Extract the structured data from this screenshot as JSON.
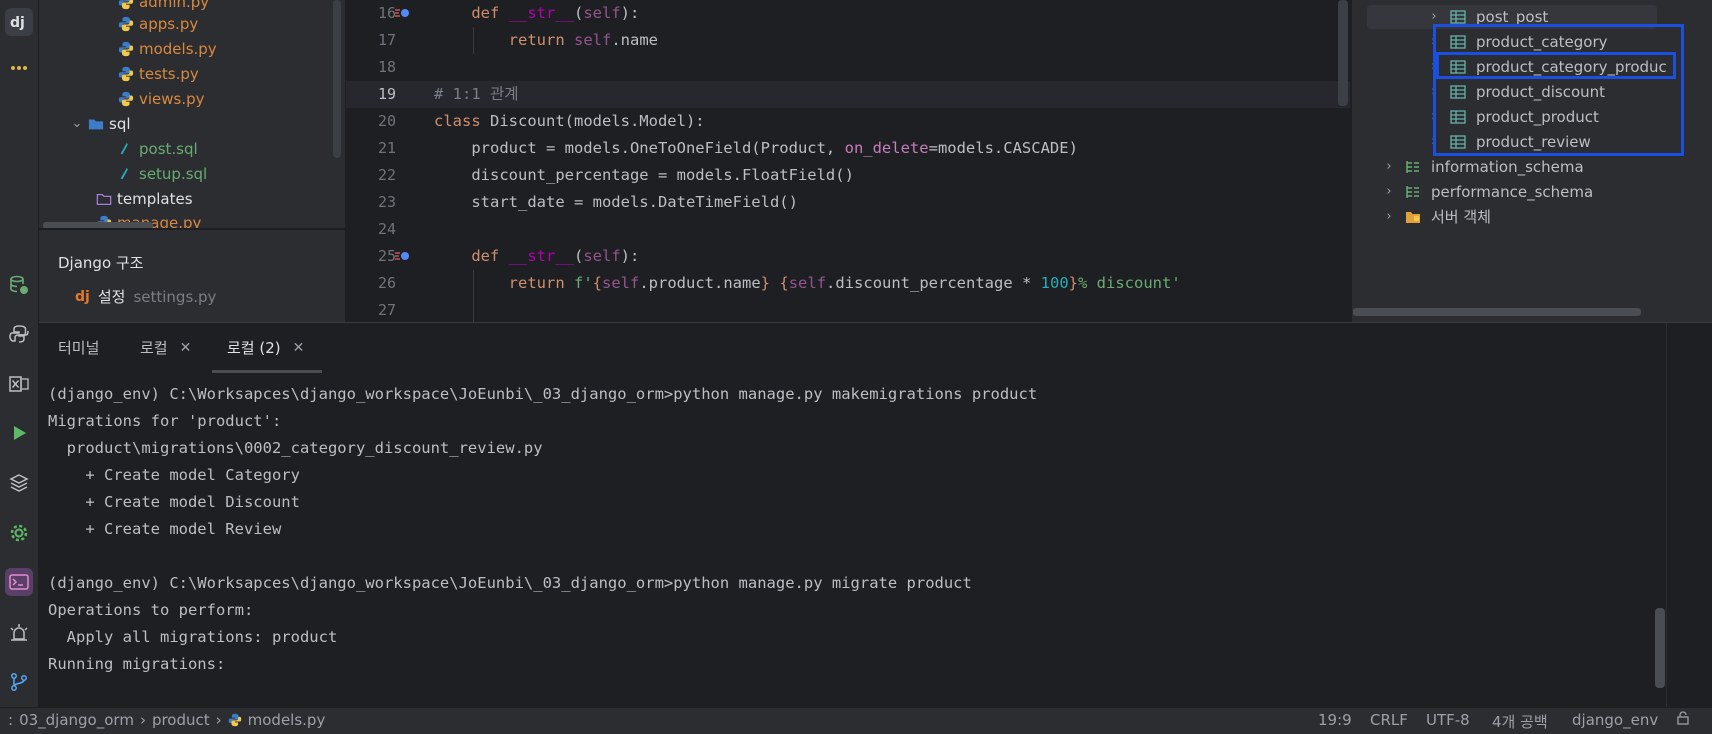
{
  "project": {
    "files": [
      {
        "name": "admin.py",
        "color": "orange"
      },
      {
        "name": "apps.py",
        "color": "orange"
      },
      {
        "name": "models.py",
        "color": "orange"
      },
      {
        "name": "tests.py",
        "color": "orange"
      },
      {
        "name": "views.py",
        "color": "orange"
      }
    ],
    "sql_folder": "sql",
    "sql_files": [
      "post.sql",
      "setup.sql"
    ],
    "templates_folder": "templates",
    "manage_file": "manage.py"
  },
  "structure": {
    "title": "Django 구조",
    "settings_label": "설정",
    "settings_file": "settings.py"
  },
  "editor": {
    "line_numbers": [
      "16",
      "17",
      "18",
      "19",
      "20",
      "21",
      "22",
      "23",
      "24",
      "25",
      "26",
      "27"
    ],
    "current_line": "19"
  },
  "database": {
    "tables": [
      "post_post",
      "product_category",
      "product_category_produc",
      "product_discount",
      "product_product",
      "product_review"
    ],
    "schemas": [
      "information_schema",
      "performance_schema",
      "서버 객체"
    ]
  },
  "terminal": {
    "tabs": [
      {
        "label": "터미널",
        "closable": false
      },
      {
        "label": "로컬",
        "closable": true
      },
      {
        "label": "로컬 (2)",
        "closable": true,
        "active": true
      }
    ],
    "lines": [
      "(django_env) C:\\Worksapces\\django_workspace\\JoEunbi\\_03_django_orm>python manage.py makemigrations product",
      "Migrations for 'product':",
      "  product\\migrations\\0002_category_discount_review.py",
      "    + Create model Category",
      "    + Create model Discount",
      "    + Create model Review",
      "",
      "(django_env) C:\\Worksapces\\django_workspace\\JoEunbi\\_03_django_orm>python manage.py migrate product",
      "Operations to perform:",
      "  Apply all migrations: product",
      "Running migrations:"
    ]
  },
  "statusbar": {
    "breadcrumb": [
      "03_django_orm",
      "product",
      "models.py"
    ],
    "position": "19:9",
    "line_ending": "CRLF",
    "encoding": "UTF-8",
    "indent": "4개 공백",
    "interpreter": "django_env"
  },
  "colors": {
    "highlight_box": "#1a4fe0",
    "accent": "#3574f0"
  }
}
